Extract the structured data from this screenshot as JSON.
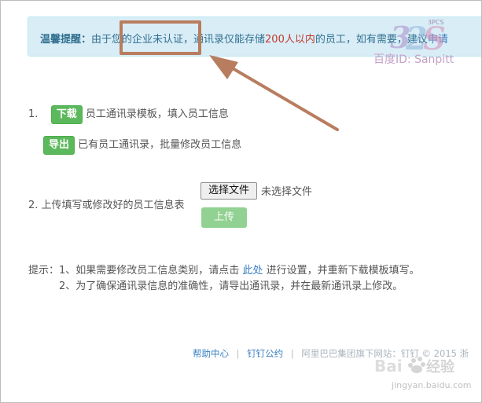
{
  "notice": {
    "label": "温馨提醒：",
    "text_a": "由于您的企业未认证，通讯录仅能存储",
    "text_red": "200人以内",
    "text_b": "的员工，如有需要，建议",
    "link": "申请"
  },
  "watermark": {
    "logo_text": "3PCS",
    "baidu_id": "百度ID: Sanpitt"
  },
  "step1": {
    "num": "1.",
    "download_button": "下载",
    "download_text": "员工通讯录模板，填入员工信息",
    "export_button": "导出",
    "export_text": "已有员工通讯录，批量修改员工信息"
  },
  "step2": {
    "num": "2.",
    "text": "上传填写或修改好的员工信息表",
    "choose_file": "选择文件",
    "no_file": "未选择文件",
    "upload_button": "上传"
  },
  "tips": {
    "prefix": "提示：1、如果需要修改员工信息类别，请点击",
    "link": "此处",
    "suffix": "进行设置，并重新下载模板填写。",
    "line2": "2、为了确保通讯录信息的准确性，请导出通讯录，并在最新通讯录上修改。"
  },
  "footer": {
    "help": "帮助中心",
    "sep": "|",
    "terms": "钉钉公约",
    "copyright": "阿里巴巴集团旗下网站：钉钉 © 2015 浙"
  },
  "jy_watermark": "jingyan.baidu.com",
  "colors": {
    "notice_bg": "#d9edf7",
    "green": "#5cb85c",
    "highlight": "#b87d5f",
    "link": "#3a7fc1"
  }
}
